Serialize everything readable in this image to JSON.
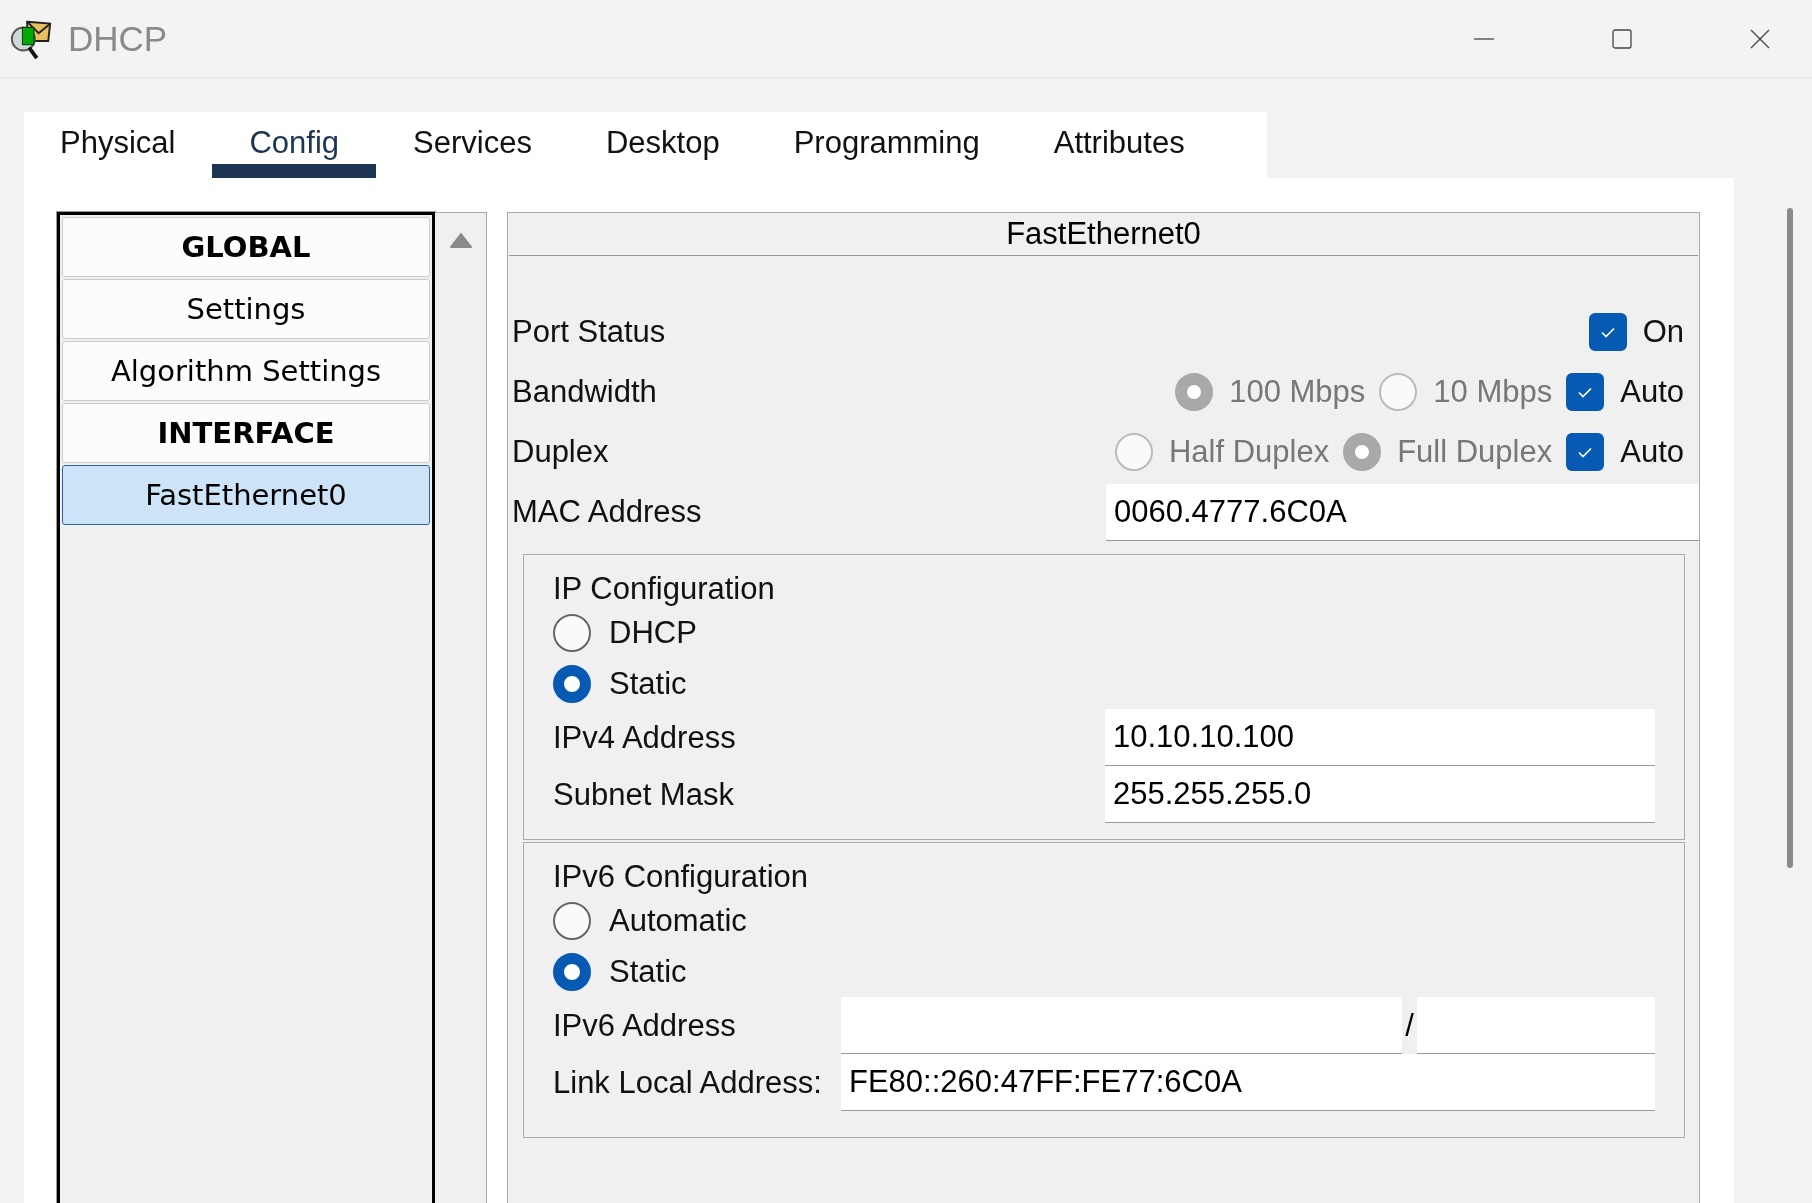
{
  "window": {
    "title": "DHCP"
  },
  "tabs": [
    {
      "label": "Physical",
      "selected": false
    },
    {
      "label": "Config",
      "selected": true
    },
    {
      "label": "Services",
      "selected": false
    },
    {
      "label": "Desktop",
      "selected": false
    },
    {
      "label": "Programming",
      "selected": false
    },
    {
      "label": "Attributes",
      "selected": false
    }
  ],
  "sidebar": {
    "items": [
      {
        "label": "GLOBAL",
        "kind": "header",
        "selected": false
      },
      {
        "label": "Settings",
        "kind": "item",
        "selected": false
      },
      {
        "label": "Algorithm Settings",
        "kind": "item",
        "selected": false
      },
      {
        "label": "INTERFACE",
        "kind": "header",
        "selected": false
      },
      {
        "label": "FastEthernet0",
        "kind": "item",
        "selected": true
      }
    ]
  },
  "interface": {
    "title": "FastEthernet0",
    "port_status": {
      "label": "Port Status",
      "checked": true,
      "option": "On"
    },
    "bandwidth": {
      "label": "Bandwidth",
      "disabled": true,
      "options": [
        {
          "label": "100 Mbps",
          "selected": true
        },
        {
          "label": "10 Mbps",
          "selected": false
        }
      ],
      "auto": {
        "label": "Auto",
        "checked": true
      }
    },
    "duplex": {
      "label": "Duplex",
      "disabled": true,
      "options": [
        {
          "label": "Half Duplex",
          "selected": false
        },
        {
          "label": "Full Duplex",
          "selected": true
        }
      ],
      "auto": {
        "label": "Auto",
        "checked": true
      }
    },
    "mac": {
      "label": "MAC Address",
      "value": "0060.4777.6C0A"
    },
    "ip_config": {
      "title": "IP Configuration",
      "modes": [
        {
          "label": "DHCP",
          "selected": false
        },
        {
          "label": "Static",
          "selected": true
        }
      ],
      "fields": [
        {
          "label": "IPv4 Address",
          "value": "10.10.10.100"
        },
        {
          "label": "Subnet Mask",
          "value": "255.255.255.0"
        }
      ]
    },
    "ipv6_config": {
      "title": "IPv6 Configuration",
      "modes": [
        {
          "label": "Automatic",
          "selected": false
        },
        {
          "label": "Static",
          "selected": true
        }
      ],
      "address": {
        "label": "IPv6 Address",
        "separator": "/"
      },
      "link_local": {
        "label": "Link Local Address:",
        "value": "FE80::260:47FF:FE77:6C0A"
      }
    }
  }
}
